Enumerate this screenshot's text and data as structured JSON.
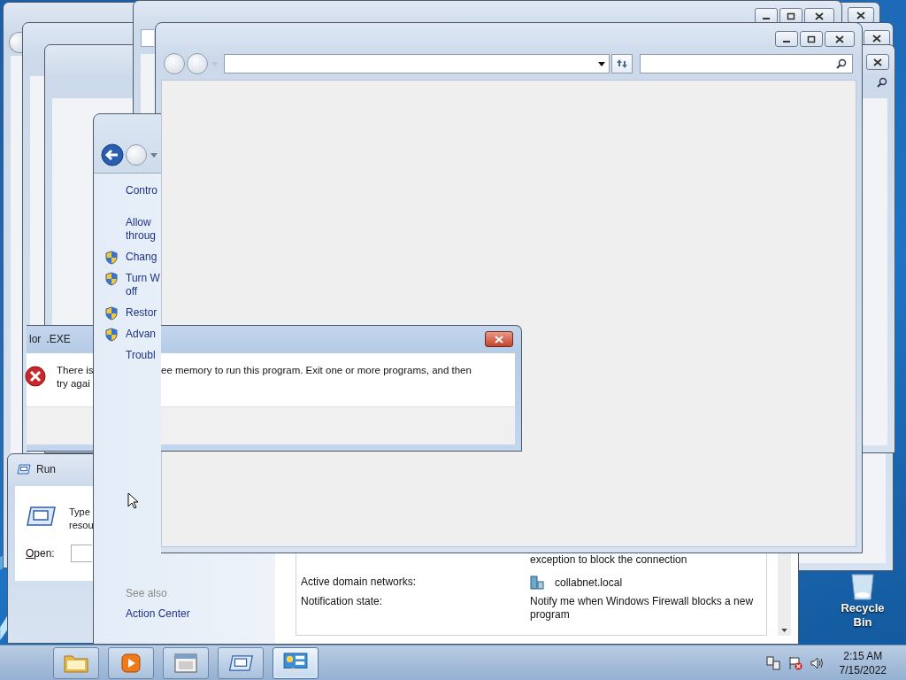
{
  "error_dialog": {
    "title_parts": [
      "lor",
      ".EXE"
    ],
    "message_left": [
      "There is",
      "try agai"
    ],
    "message_right": "ee memory to run this program. Exit one or more programs, and then"
  },
  "firewall": {
    "nav_items": [
      {
        "lines": [
          "Contro"
        ],
        "kind": "link"
      },
      {
        "lines": [
          "Allow",
          "throug"
        ],
        "kind": "link"
      },
      {
        "lines": [
          "Chang"
        ],
        "kind": "shield"
      },
      {
        "lines": [
          "Turn W",
          "off"
        ],
        "kind": "shield"
      },
      {
        "lines": [
          "Restor"
        ],
        "kind": "shield"
      },
      {
        "lines": [
          "Advan"
        ],
        "kind": "shield"
      },
      {
        "lines": [
          "Troubl"
        ],
        "kind": "link"
      }
    ],
    "see_also_heading": "See also",
    "see_also": [
      "Action Center"
    ],
    "details": [
      {
        "value": "exception to block the connection"
      },
      {
        "label": "Active domain networks:",
        "value": "collabnet.local",
        "kind": "network"
      },
      {
        "label": "Notification state:",
        "value": "Notify me when Windows Firewall blocks a new program"
      }
    ]
  },
  "run_dialog": {
    "title": "Run",
    "description": [
      "Type",
      "resou"
    ],
    "open_label": "Open:"
  },
  "recycle_bin": {
    "label": "Recycle Bin"
  },
  "taskbar": {
    "buttons": [
      {
        "kind": "folder",
        "selected": false
      },
      {
        "kind": "media",
        "selected": false
      },
      {
        "kind": "window",
        "selected": false
      },
      {
        "kind": "run",
        "selected": false
      },
      {
        "kind": "control-panel",
        "selected": true
      }
    ],
    "tray": [
      {
        "kind": "network"
      },
      {
        "kind": "flag-error"
      },
      {
        "kind": "speaker"
      }
    ],
    "time": "2:15 AM",
    "date": "7/15/2022"
  }
}
